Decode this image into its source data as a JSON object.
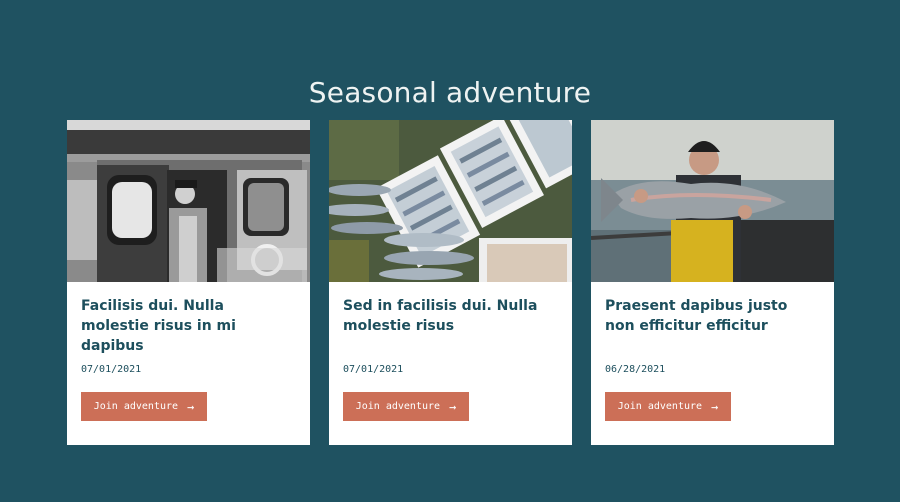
{
  "page": {
    "title": "Seasonal adventure"
  },
  "cards": [
    {
      "title": "Facilisis dui. Nulla molestie risus in mi dapibus",
      "date": "07/01/2021",
      "cta_label": "Join adventure",
      "cta_icon": "arrow-right-icon",
      "photo": "fisherman-in-boat-cabin-bw"
    },
    {
      "title": "Sed in facilisis dui. Nulla molestie risus",
      "date": "07/01/2021",
      "cta_label": "Join adventure",
      "cta_icon": "arrow-right-icon",
      "photo": "fish-crates-on-grass"
    },
    {
      "title": "Praesent dapibus justo non efficitur efficitur",
      "date": "06/28/2021",
      "cta_label": "Join adventure",
      "cta_icon": "arrow-right-icon",
      "photo": "fisherman-holding-salmon"
    }
  ],
  "colors": {
    "background": "#1f5261",
    "card": "#ffffff",
    "text_dark": "#1d4f5d",
    "button": "#cc6f57",
    "button_text": "#ffffff",
    "title_text": "#eef3f2"
  }
}
